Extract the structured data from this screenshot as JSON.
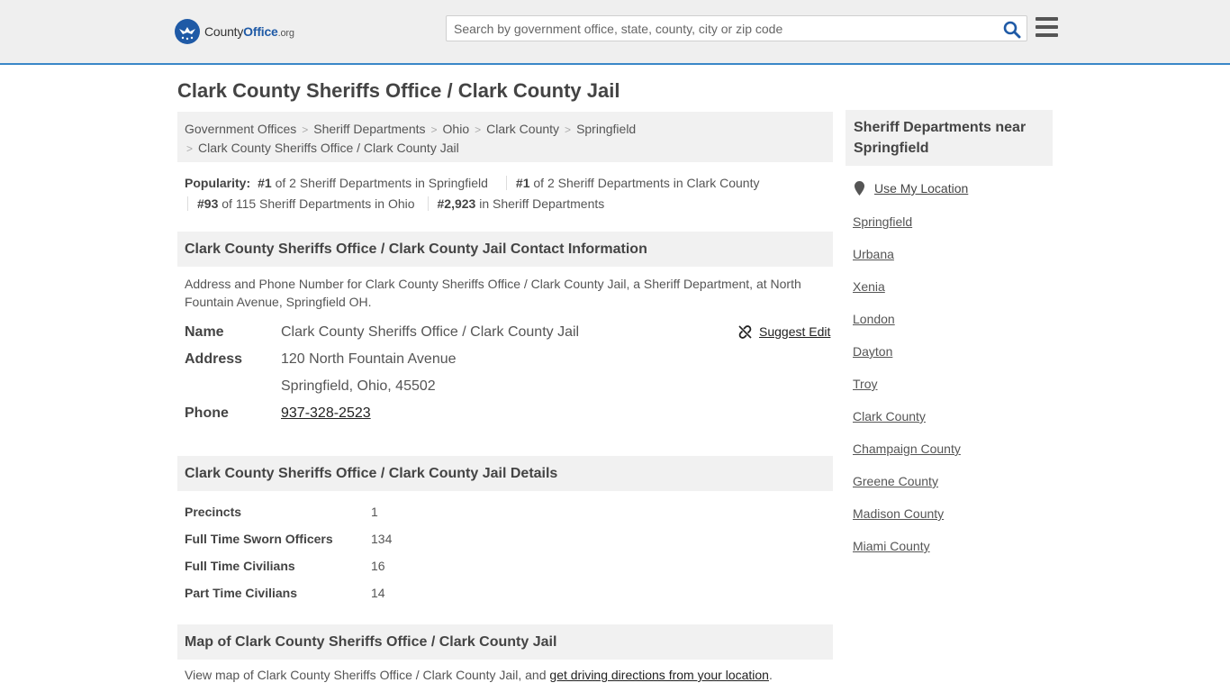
{
  "header": {
    "logo_county": "County",
    "logo_office": "Office",
    "logo_org": ".org",
    "search_placeholder": "Search by government office, state, county, city or zip code"
  },
  "page_title": "Clark County Sheriffs Office / Clark County Jail",
  "breadcrumb": [
    "Government Offices",
    "Sheriff Departments",
    "Ohio",
    "Clark County",
    "Springfield",
    "Clark County Sheriffs Office / Clark County Jail"
  ],
  "popularity": {
    "label": "Popularity:",
    "items": [
      {
        "rank": "#1",
        "text": "of 2 Sheriff Departments in Springfield"
      },
      {
        "rank": "#1",
        "text": "of 2 Sheriff Departments in Clark County"
      },
      {
        "rank": "#93",
        "text": "of 115 Sheriff Departments in Ohio"
      },
      {
        "rank": "#2,923",
        "text": "in Sheriff Departments"
      }
    ]
  },
  "contact": {
    "heading": "Clark County Sheriffs Office / Clark County Jail Contact Information",
    "description": "Address and Phone Number for Clark County Sheriffs Office / Clark County Jail, a Sheriff Department, at North Fountain Avenue, Springfield OH.",
    "name_label": "Name",
    "name_value": "Clark County Sheriffs Office / Clark County Jail",
    "address_label": "Address",
    "address_line1": "120 North Fountain Avenue",
    "address_line2": "Springfield, Ohio, 45502",
    "phone_label": "Phone",
    "phone_value": "937-328-2523",
    "suggest_edit": "Suggest Edit"
  },
  "details": {
    "heading": "Clark County Sheriffs Office / Clark County Jail Details",
    "rows": [
      {
        "label": "Precincts",
        "value": "1"
      },
      {
        "label": "Full Time Sworn Officers",
        "value": "134"
      },
      {
        "label": "Full Time Civilians",
        "value": "16"
      },
      {
        "label": "Part Time Civilians",
        "value": "14"
      }
    ]
  },
  "map": {
    "heading": "Map of Clark County Sheriffs Office / Clark County Jail",
    "text": "View map of Clark County Sheriffs Office / Clark County Jail, and ",
    "link": "get driving directions from your location",
    "end": "."
  },
  "sidebar": {
    "heading": "Sheriff Departments near Springfield",
    "use_location": "Use My Location",
    "links": [
      "Springfield",
      "Urbana",
      "Xenia",
      "London",
      "Dayton",
      "Troy",
      "Clark County",
      "Champaign County",
      "Greene County",
      "Madison County",
      "Miami County"
    ]
  },
  "colors": {
    "accent": "#3a87c8",
    "brand": "#1f5aa6",
    "panel": "#f1f1f1"
  }
}
